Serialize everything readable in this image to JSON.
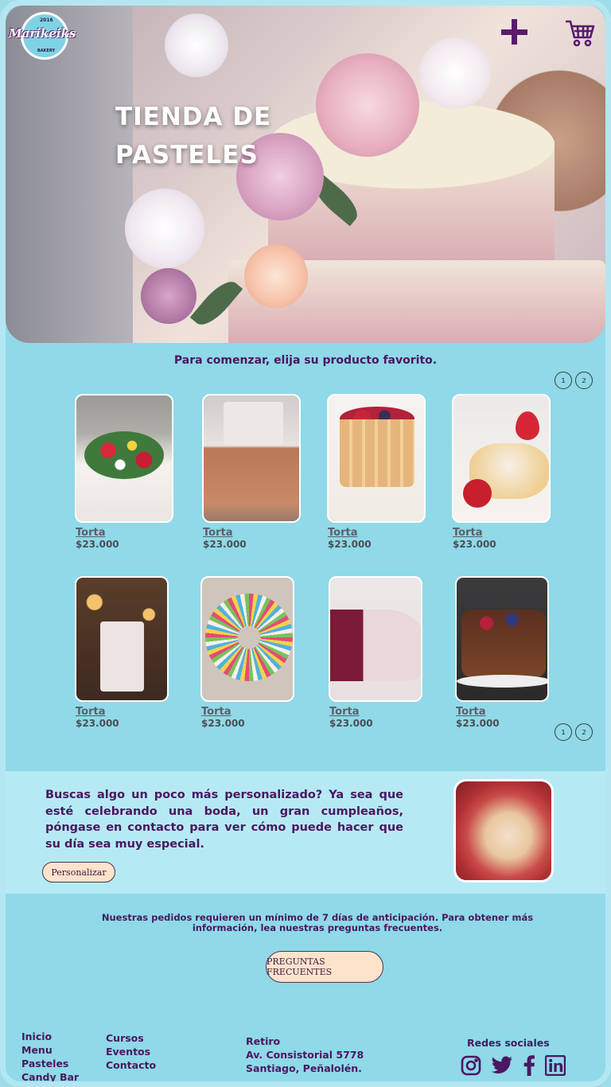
{
  "brand": {
    "script": "Marikeiks",
    "year": "2016",
    "tagline": "BAKERY"
  },
  "header": {
    "title": "TIENDA DE PASTELES",
    "add_icon": "plus-icon",
    "cart_icon": "shopping-cart-icon"
  },
  "products": {
    "intro": "Para comenzar, elija su producto favorito.",
    "pages": [
      "1",
      "2"
    ],
    "items": [
      {
        "name": "Torta",
        "price": "$23.000",
        "theme": "white-floral-cake"
      },
      {
        "name": "Torta",
        "price": "$23.000",
        "theme": "rose-gold-tier-cake"
      },
      {
        "name": "Torta",
        "price": "$23.000",
        "theme": "berry-charlotte"
      },
      {
        "name": "Torta",
        "price": "$23.000",
        "theme": "strawberry-shortcake"
      },
      {
        "name": "Torta",
        "price": "$23.000",
        "theme": "rustic-wedding-cake"
      },
      {
        "name": "Torta",
        "price": "$23.000",
        "theme": "sprinkle-donut"
      },
      {
        "name": "Torta",
        "price": "$23.000",
        "theme": "red-velvet-slice"
      },
      {
        "name": "Torta",
        "price": "$23.000",
        "theme": "chocolate-drip-cake"
      }
    ]
  },
  "custom": {
    "text": "Buscas algo un poco más personalizado? Ya sea que esté celebrando una boda, un gran cumpleaños, póngase en contacto para ver cómo puede hacer que su día sea muy especial.",
    "button": "Personalizar"
  },
  "faq": {
    "note": "Nuestras pedidos requieren un mínimo de 7 días de anticipación. Para obtener más información, lea nuestras preguntas frecuentes.",
    "button": "PREGUNTAS FRECUENTES"
  },
  "footer": {
    "nav1": [
      "Inicio",
      "Menu",
      "Pasteles",
      "Candy Bar"
    ],
    "nav2": [
      "Cursos",
      "Eventos",
      "Contacto"
    ],
    "address": [
      "Retiro",
      "Av. Consistorial 5778",
      "Santiago, Peñalolén."
    ],
    "social_title": "Redes sociales",
    "social_icons": [
      "instagram-icon",
      "twitter-icon",
      "facebook-icon",
      "linkedin-icon"
    ]
  },
  "colors": {
    "background": "#8fd9e8",
    "accent_text": "#4a1760",
    "button_fill": "#fde3cc"
  }
}
